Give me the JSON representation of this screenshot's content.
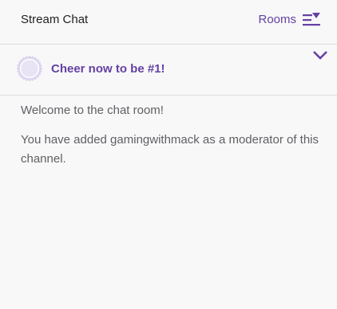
{
  "header": {
    "title": "Stream Chat",
    "rooms_label": "Rooms",
    "rooms_icon": "rooms-list-icon"
  },
  "cheer": {
    "text": "Cheer now to be #1!",
    "badge_icon": "cheer-badge-icon",
    "expand_icon": "chevron-down-icon"
  },
  "messages": [
    {
      "text": "Welcome to the chat room!"
    },
    {
      "text": "You have added gamingwithmack as a moderator of this channel."
    }
  ],
  "colors": {
    "accent": "#6441a4",
    "badge": "#dcd4ef",
    "background": "#f8f8f8",
    "text": "#5f5f65"
  }
}
